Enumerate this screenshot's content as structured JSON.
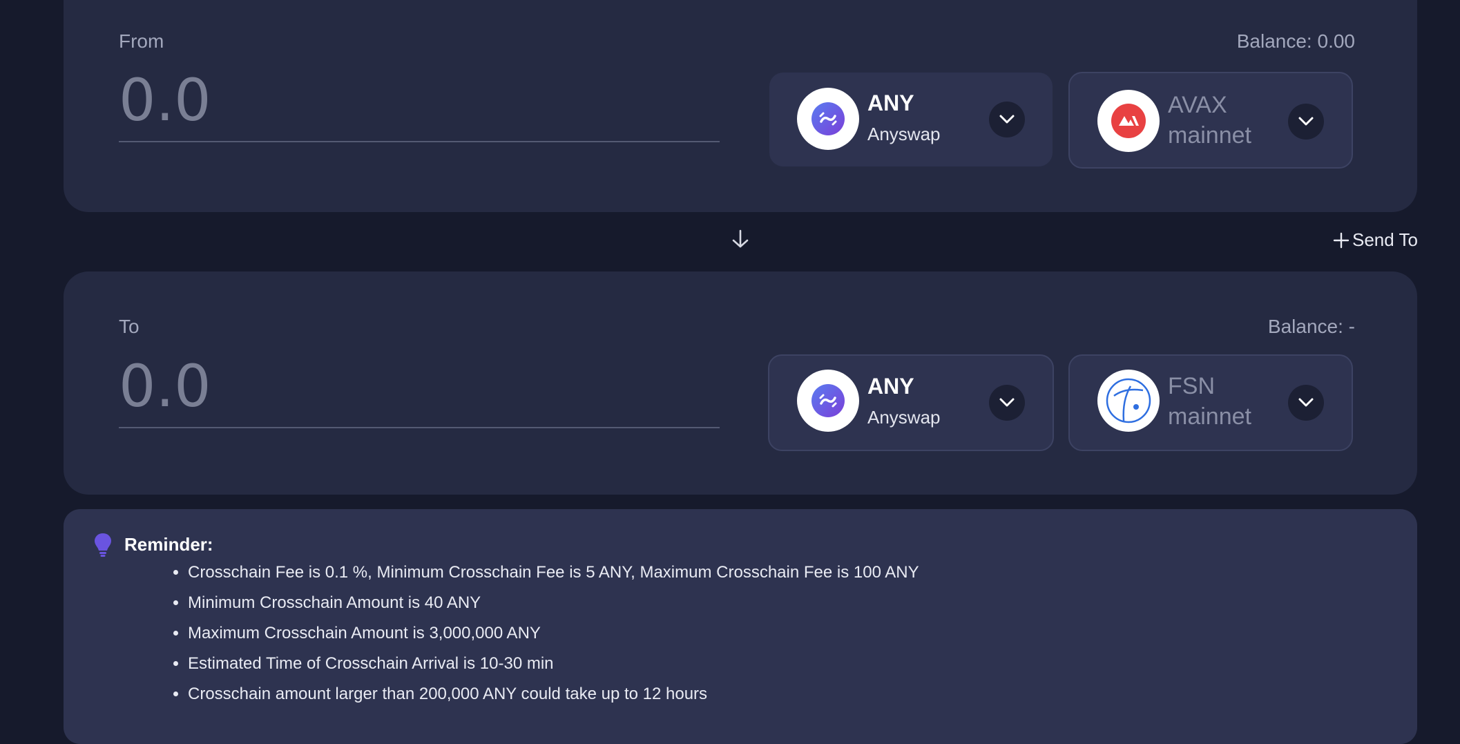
{
  "from": {
    "label": "From",
    "balance": "Balance: 0.00",
    "amount_placeholder": "0.0",
    "token": {
      "symbol": "ANY",
      "name": "Anyswap",
      "icon": "anyswap-icon"
    },
    "chain": {
      "name": "AVAX mainnet",
      "icon": "avalanche-icon",
      "color": "#e84142"
    }
  },
  "send_to_label": "Send To",
  "to": {
    "label": "To",
    "balance": "Balance: -",
    "amount_placeholder": "0.0",
    "token": {
      "symbol": "ANY",
      "name": "Anyswap",
      "icon": "anyswap-icon"
    },
    "chain": {
      "name": "FSN mainnet",
      "icon": "fusion-icon",
      "color": "#2e6ee0"
    }
  },
  "reminder": {
    "title": "Reminder:",
    "items": [
      "Crosschain Fee is 0.1 %, Minimum Crosschain Fee is 5 ANY, Maximum Crosschain Fee is 100 ANY",
      "Minimum Crosschain Amount is 40 ANY",
      "Maximum Crosschain Amount is 3,000,000 ANY",
      "Estimated Time of Crosschain Arrival is 10-30 min",
      "Crosschain amount larger than 200,000 ANY could take up to 12 hours"
    ]
  },
  "colors": {
    "background": "#161a2c",
    "panel": "#252a42",
    "selector": "#2e3350",
    "accent": "#6a54e0"
  }
}
